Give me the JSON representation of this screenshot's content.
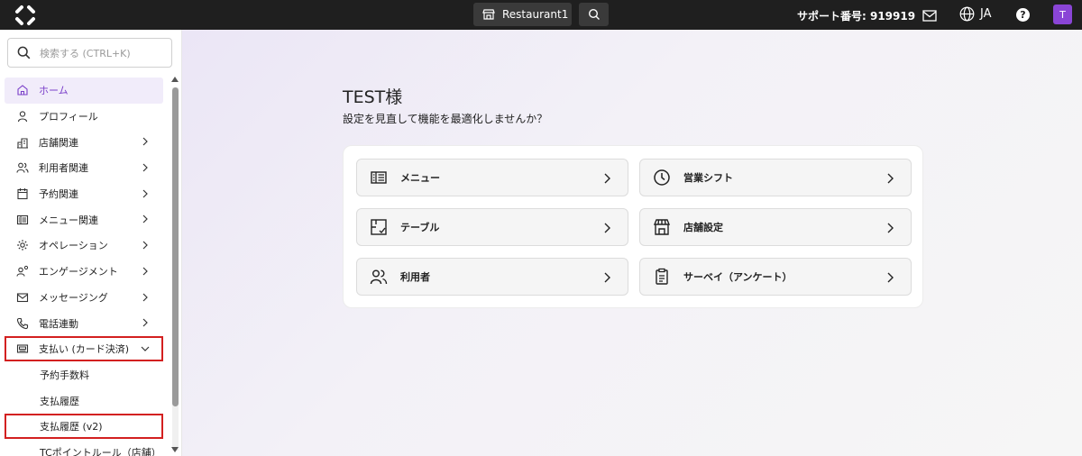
{
  "topbar": {
    "store_name": "Restaurant1",
    "support_label": "サポート番号: 919919",
    "lang": "JA",
    "help_glyph": "?",
    "avatar_initial": "T"
  },
  "sidebar": {
    "search_placeholder": "検索する (CTRL+K)",
    "items": [
      {
        "label": "ホーム",
        "icon": "home-icon",
        "active": true,
        "chevron": false
      },
      {
        "label": "プロフィール",
        "icon": "user-icon",
        "chevron": false
      },
      {
        "label": "店舗関連",
        "icon": "store-icon",
        "chevron": true
      },
      {
        "label": "利用者関連",
        "icon": "users-icon",
        "chevron": true
      },
      {
        "label": "予約関連",
        "icon": "calendar-icon",
        "chevron": true
      },
      {
        "label": "メニュー関連",
        "icon": "menu-book-icon",
        "chevron": true
      },
      {
        "label": "オペレーション",
        "icon": "gear-icon",
        "chevron": true
      },
      {
        "label": "エンゲージメント",
        "icon": "engagement-icon",
        "chevron": true
      },
      {
        "label": "メッセージング",
        "icon": "mail-icon",
        "chevron": true
      },
      {
        "label": "電話連動",
        "icon": "phone-icon",
        "chevron": true
      },
      {
        "label": "支払い (カード決済)",
        "icon": "payment-icon",
        "chevron": "down",
        "highlighted": true
      },
      {
        "label": "予約手数料",
        "sub": true
      },
      {
        "label": "支払履歴",
        "sub": true
      },
      {
        "label": "支払履歴 (v2)",
        "sub": true,
        "highlighted": true
      },
      {
        "label": "TCポイントルール（店舗）",
        "sub": true
      }
    ]
  },
  "main": {
    "greeting": "TEST様",
    "subtitle": "設定を見直して機能を最適化しませんか？",
    "tiles": [
      {
        "label": "メニュー",
        "icon": "menu-book-icon"
      },
      {
        "label": "営業シフト",
        "icon": "clock-icon"
      },
      {
        "label": "テーブル",
        "icon": "table-icon"
      },
      {
        "label": "店舗設定",
        "icon": "storefront-icon"
      },
      {
        "label": "利用者",
        "icon": "users-icon"
      },
      {
        "label": "サーベイ（アンケート）",
        "icon": "clipboard-icon"
      }
    ]
  },
  "colors": {
    "accent": "#8a45d6",
    "topbar_bg": "#1f1f1f",
    "highlight_border": "#d32020"
  }
}
